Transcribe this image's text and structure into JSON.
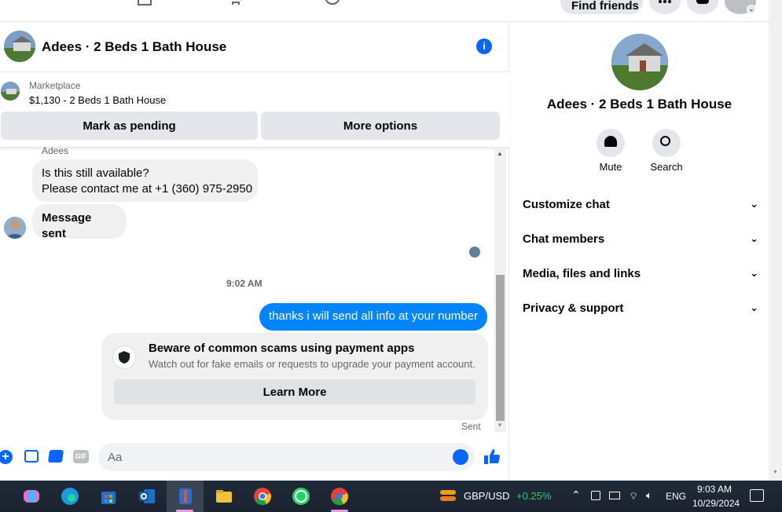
{
  "topbar": {
    "find_friends": "Find friends"
  },
  "chat": {
    "title": "Adees · 2 Beds 1 Bath House",
    "marketplace_label": "Marketplace",
    "listing": "$1,130 - 2 Beds 1 Bath House",
    "mark_pending": "Mark as pending",
    "more_options": "More options",
    "sender_name": "Adees",
    "msg1_line1": "Is this still available?",
    "msg1_line2": "Please contact me at +1 (360) 975-2950",
    "msg2": "Message sent",
    "timestamp": "9:02 AM",
    "msg_out": "thanks i will send all info at your number",
    "scam_title": "Beware of common scams using payment apps",
    "scam_body": "Watch out for fake emails or requests to upgrade your payment account.",
    "learn_more": "Learn More",
    "sent_status": "Sent",
    "composer_placeholder": "Aa",
    "gif_label": "GIF"
  },
  "sidebar": {
    "title": "Adees · 2 Beds 1 Bath House",
    "mute": "Mute",
    "search": "Search",
    "sections": [
      "Customize chat",
      "Chat members",
      "Media, files and links",
      "Privacy & support"
    ]
  },
  "taskbar": {
    "ticker": "GBP/USD",
    "change": "+0.25%",
    "lang": "ENG",
    "time": "9:03 AM",
    "date": "10/29/2024"
  },
  "colors": {
    "accent": "#0084ff",
    "messenger_blue": "#0866ff",
    "positive": "#2ecc71"
  }
}
